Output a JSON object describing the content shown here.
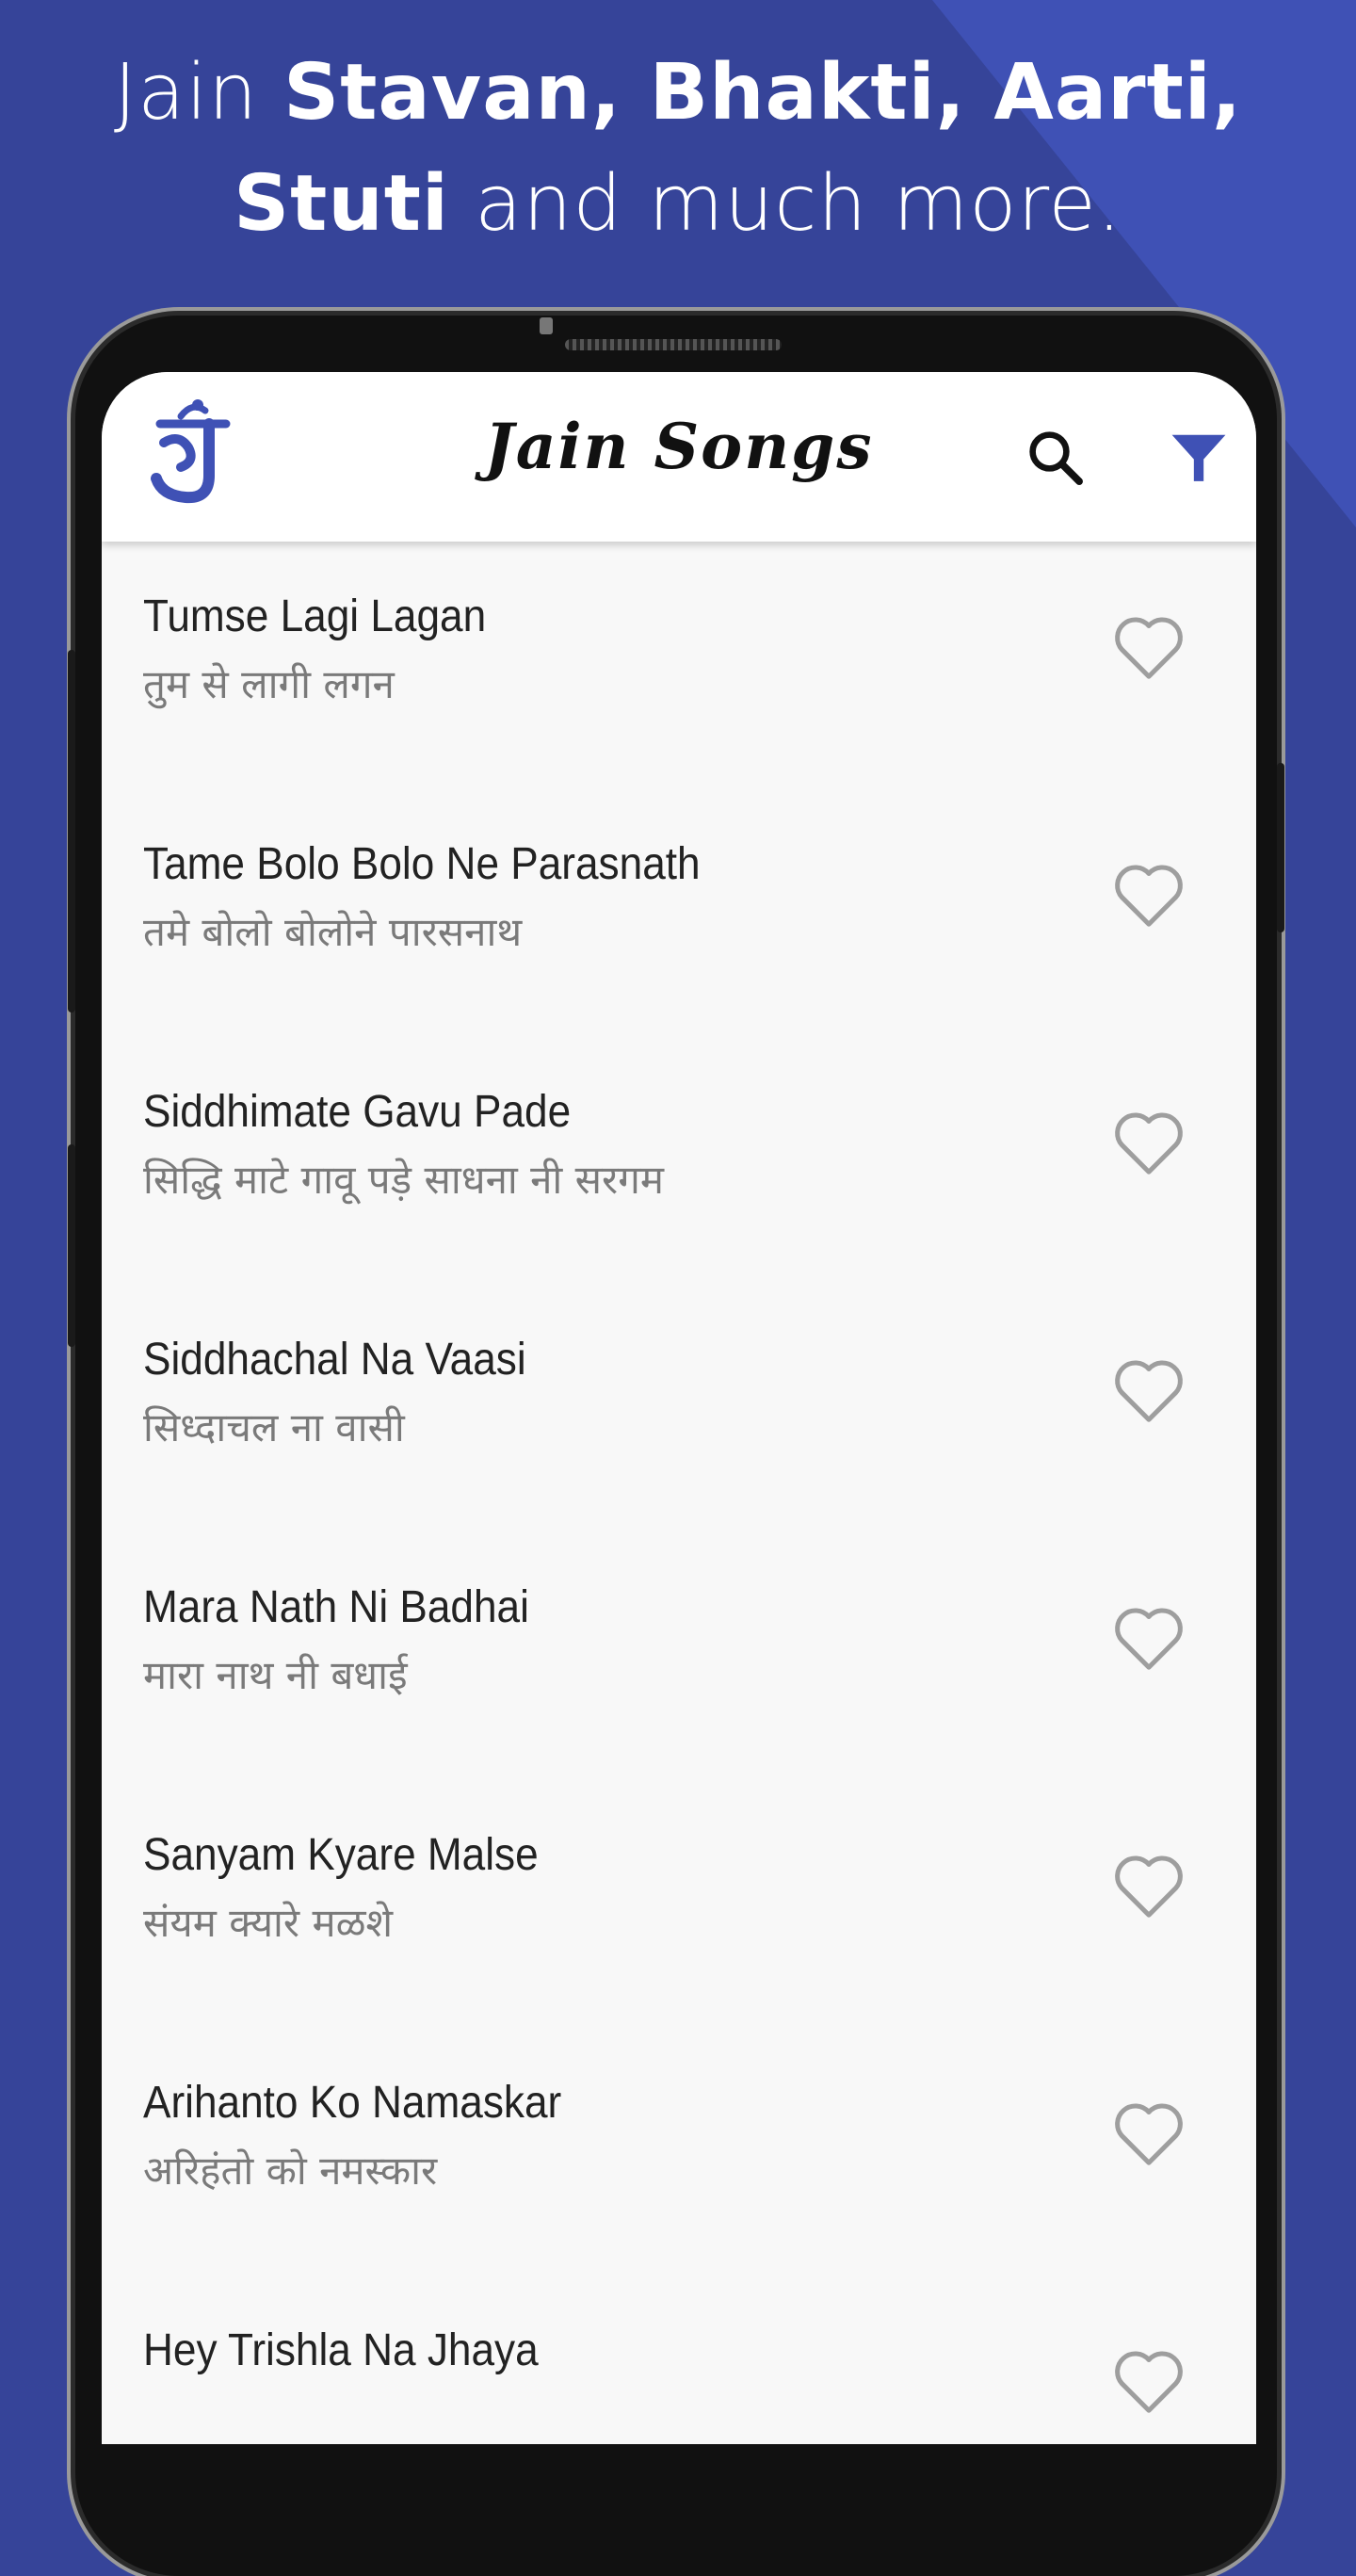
{
  "promo": {
    "line1_prefix": "Jain ",
    "line1_bold": "Stavan, Bhakti, Aarti,",
    "line2_bold": "Stuti",
    "line2_suffix": " and much more."
  },
  "appbar": {
    "logo_icon": "jain-logo-icon",
    "title": "Jain Songs",
    "search_icon": "search-icon",
    "filter_icon": "filter-icon"
  },
  "songs": [
    {
      "title": "Tumse Lagi Lagan",
      "subtitle": "तुम से लागी लगन"
    },
    {
      "title": "Tame Bolo Bolo Ne Parasnath",
      "subtitle": "तमे बोलो बोलोने पारसनाथ"
    },
    {
      "title": "Siddhimate Gavu Pade",
      "subtitle": "सिद्धि माटे गावू पड़े साधना नी सरगम"
    },
    {
      "title": "Siddhachal Na Vaasi",
      "subtitle": "सिध्दाचल ना वासी"
    },
    {
      "title": "Mara Nath Ni Badhai",
      "subtitle": "मारा नाथ नी बधाई"
    },
    {
      "title": "Sanyam Kyare Malse",
      "subtitle": "संयम क्यारे मळशे"
    },
    {
      "title": "Arihanto Ko Namaskar",
      "subtitle": "अरिहंतो को नमस्कार"
    },
    {
      "title": "Hey Trishla Na Jhaya",
      "subtitle": ""
    }
  ],
  "colors": {
    "background": "#364499",
    "background_light": "#3f51b5",
    "accent": "#3f51b5",
    "heart_outline": "#9e9e9e"
  }
}
